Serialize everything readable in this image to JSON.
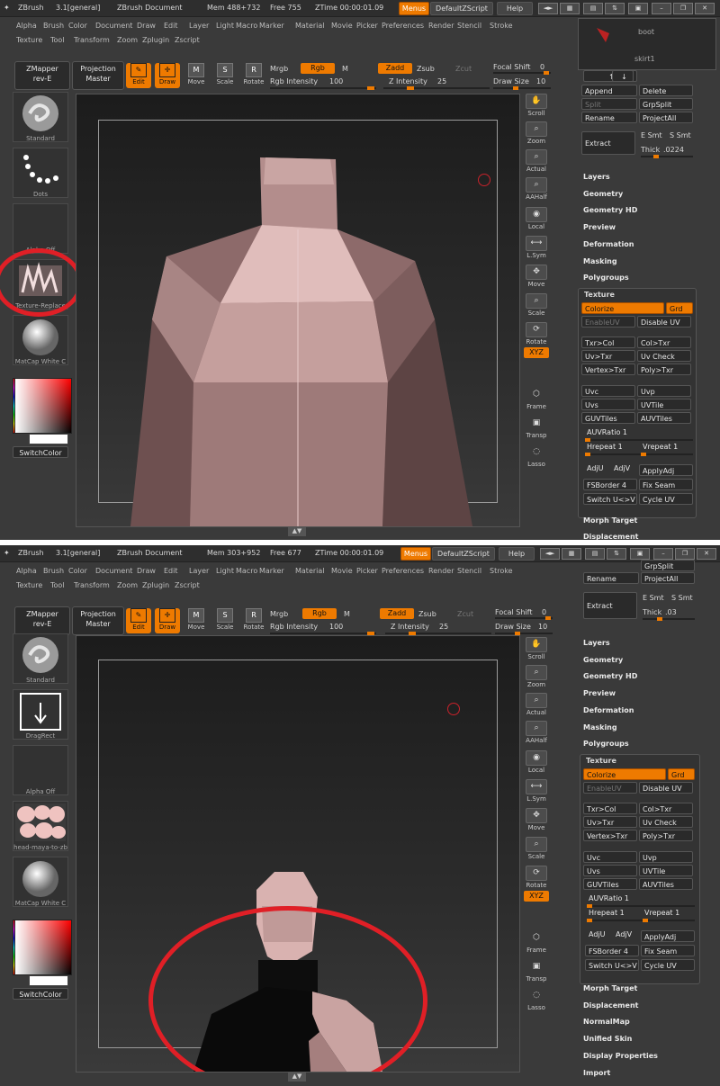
{
  "top": {
    "app_title": "ZBrush",
    "version": "3.1[general]",
    "doc": "ZBrush Document",
    "mem": "Mem 488+732",
    "free": "Free 755",
    "ztime": "ZTime 00:00:01.09",
    "menus_btn": "Menus",
    "script_btn": "DefaultZScript",
    "help_btn": "Help",
    "menu_row1": [
      "Alpha",
      "Brush",
      "Color",
      "Document",
      "Draw",
      "Edit",
      "Layer",
      "Light",
      "Macro",
      "Marker",
      "Material",
      "Movie",
      "Picker",
      "Preferences",
      "Render",
      "Stencil",
      "Stroke"
    ],
    "menu_row2": [
      "Texture",
      "Tool",
      "Transform",
      "Zoom",
      "Zplugin",
      "Zscript"
    ],
    "zmapper": [
      "ZMapper",
      "rev-E"
    ],
    "projection": [
      "Projection",
      "Master"
    ],
    "tools": [
      "Edit",
      "Draw",
      "Move",
      "Scale",
      "Rotate"
    ],
    "mrgb": "Mrgb",
    "rgb": "Rgb",
    "m": "M",
    "rgb_intensity_label": "Rgb Intensity",
    "rgb_intensity": "100",
    "zadd": "Zadd",
    "zsub": "Zsub",
    "zcut": "Zcut",
    "z_intensity_label": "Z Intensity",
    "z_intensity": "25",
    "focal_label": "Focal Shift",
    "focal": "0",
    "draw_size_label": "Draw Size",
    "draw_size": "10",
    "left": {
      "brush": "Standard",
      "stroke": "Dots",
      "alpha": "Alpha Off",
      "texture": "Texture-Replace",
      "material": "MatCap White C",
      "switch": "SwitchColor"
    },
    "rtools": [
      "Scroll",
      "Zoom",
      "Actual",
      "AAHalf",
      "Local",
      "L.Sym",
      "Move",
      "Scale",
      "Rotate",
      "XYZ",
      "Frame",
      "Transp",
      "Lasso"
    ],
    "subtools": {
      "a": "boot",
      "b": "skirt1"
    },
    "rbtns": {
      "append": "Append",
      "delete": "Delete",
      "split": "Split",
      "grpsplit": "GrpSplit",
      "rename": "Rename",
      "projectall": "ProjectAll",
      "extract": "Extract",
      "esmt": "E Smt",
      "ssmt": "S Smt",
      "thick": "Thick",
      "thick_val": ".0224"
    },
    "sections": [
      "Layers",
      "Geometry",
      "Geometry HD",
      "Preview",
      "Deformation",
      "Masking",
      "Polygroups"
    ],
    "texture_title": "Texture",
    "tex": {
      "colorize": "Colorize",
      "grd": "Grd",
      "enableuv": "EnableUV",
      "disableuv": "Disable UV",
      "txrcol": "Txr>Col",
      "coltxr": "Col>Txr",
      "uvtxr": "Uv>Txr",
      "uvcheck": "Uv Check",
      "vertextxr": "Vertex>Txr",
      "polytxr": "Poly>Txr",
      "uvc": "Uvc",
      "uvp": "Uvp",
      "uvs": "Uvs",
      "uvtile": "UVTile",
      "guvtiles": "GUVTiles",
      "auvtiles": "AUVTiles",
      "auvratio": "AUVRatio 1",
      "hrepeat": "Hrepeat 1",
      "vrepeat": "Vrepeat 1",
      "adju": "AdjU",
      "adjv": "AdjV",
      "applyadj": "ApplyAdj",
      "fsborder": "FSBorder 4",
      "fixseam": "Fix Seam",
      "switchuv": "Switch U<>V",
      "cycleuv": "Cycle UV"
    },
    "after": [
      "Morph Target",
      "Displacement"
    ]
  },
  "bottom": {
    "app_title": "ZBrush",
    "version": "3.1[general]",
    "doc": "ZBrush Document",
    "mem": "Mem 303+952",
    "free": "Free 677",
    "ztime": "ZTime 00:00:01.09",
    "menus_btn": "Menus",
    "script_btn": "DefaultZScript",
    "help_btn": "Help",
    "menu_row1": [
      "Alpha",
      "Brush",
      "Color",
      "Document",
      "Draw",
      "Edit",
      "Layer",
      "Light",
      "Macro",
      "Marker",
      "Material",
      "Movie",
      "Picker",
      "Preferences",
      "Render",
      "Stencil",
      "Stroke"
    ],
    "menu_row2": [
      "Texture",
      "Tool",
      "Transform",
      "Zoom",
      "Zplugin",
      "Zscript"
    ],
    "zmapper": [
      "ZMapper",
      "rev-E"
    ],
    "projection": [
      "Projection",
      "Master"
    ],
    "tools": [
      "Edit",
      "Draw",
      "Move",
      "Scale",
      "Rotate"
    ],
    "mrgb": "Mrgb",
    "rgb": "Rgb",
    "m": "M",
    "rgb_intensity_label": "Rgb Intensity",
    "rgb_intensity": "100",
    "zadd": "Zadd",
    "zsub": "Zsub",
    "zcut": "Zcut",
    "z_intensity_label": "Z Intensity",
    "z_intensity": "25",
    "focal_label": "Focal Shift",
    "focal": "0",
    "draw_size_label": "Draw Size",
    "draw_size": "10",
    "left": {
      "brush": "Standard",
      "stroke": "DragRect",
      "alpha": "Alpha Off",
      "texture": "head-maya-to-zb",
      "material": "MatCap White C",
      "switch": "SwitchColor"
    },
    "rtools": [
      "Scroll",
      "Zoom",
      "Actual",
      "AAHalf",
      "Local",
      "L.Sym",
      "Move",
      "Scale",
      "Rotate",
      "XYZ",
      "Frame",
      "Transp",
      "Lasso"
    ],
    "rbtns": {
      "grpsplit": "GrpSplit",
      "rename": "Rename",
      "projectall": "ProjectAll",
      "extract": "Extract",
      "esmt": "E Smt",
      "ssmt": "S Smt",
      "thick": "Thick",
      "thick_val": ".03"
    },
    "sections": [
      "Layers",
      "Geometry",
      "Geometry HD",
      "Preview",
      "Deformation",
      "Masking",
      "Polygroups"
    ],
    "texture_title": "Texture",
    "tex": {
      "colorize": "Colorize",
      "grd": "Grd",
      "enableuv": "EnableUV",
      "disableuv": "Disable UV",
      "txrcol": "Txr>Col",
      "coltxr": "Col>Txr",
      "uvtxr": "Uv>Txr",
      "uvcheck": "Uv Check",
      "vertextxr": "Vertex>Txr",
      "polytxr": "Poly>Txr",
      "uvc": "Uvc",
      "uvp": "Uvp",
      "uvs": "Uvs",
      "uvtile": "UVTile",
      "guvtiles": "GUVTiles",
      "auvtiles": "AUVTiles",
      "auvratio": "AUVRatio 1",
      "hrepeat": "Hrepeat 1",
      "vrepeat": "Vrepeat 1",
      "adju": "AdjU",
      "adjv": "AdjV",
      "applyadj": "ApplyAdj",
      "fsborder": "FSBorder 4",
      "fixseam": "Fix Seam",
      "switchuv": "Switch U<>V",
      "cycleuv": "Cycle UV"
    },
    "after": [
      "Morph Target",
      "Displacement",
      "NormalMap",
      "Unified Skin",
      "Display Properties",
      "Import"
    ]
  },
  "colors": {
    "accent": "#ee7a00",
    "bg": "#3a3a3a",
    "annotation": "#e01f26",
    "skin": "#e9c0bd"
  }
}
